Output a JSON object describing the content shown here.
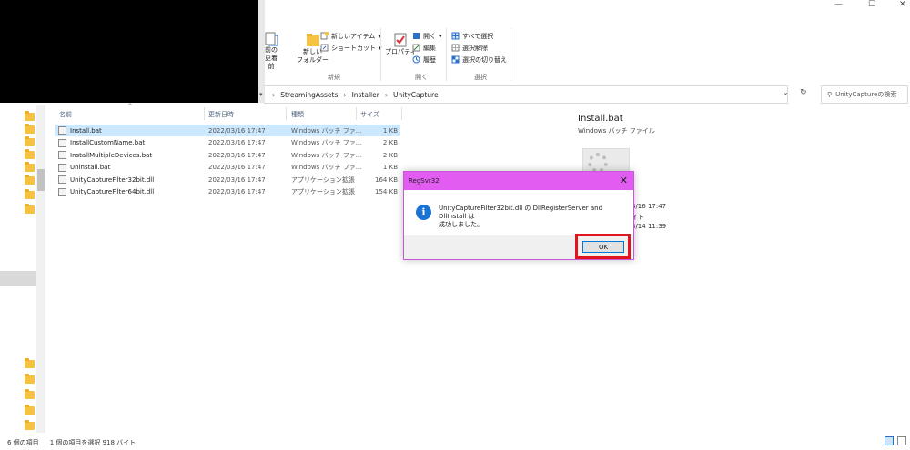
{
  "ribbon": {
    "truncated_copy_labels": [
      "コ",
      "剣"
    ],
    "move_label_lines": [
      "移動",
      "先"
    ],
    "copy_to_label_lines": [
      "前の",
      "更着",
      "前"
    ],
    "new_folder_label_lines": [
      "新しい",
      "フォルダー"
    ],
    "new_item_label": "新しいアイテム",
    "shortcut_label": "ショートカット",
    "new_group_label": "新規",
    "properties_label": "プロパティ",
    "open_label": "開く",
    "edit_label": "編集",
    "history_label": "履歴",
    "open_group_label": "開く",
    "select_all_label": "すべて選択",
    "select_none_label": "選択解除",
    "invert_selection_label": "選択の切り替え",
    "select_group_label": "選択"
  },
  "address": {
    "breadcrumbs": [
      "StreamingAssets",
      "Installer",
      "UnityCapture"
    ]
  },
  "search": {
    "placeholder": "UnityCaptureの検索"
  },
  "columns": {
    "name": "名前",
    "date": "更新日時",
    "type": "種類",
    "size": "サイズ"
  },
  "files": [
    {
      "name": "Install.bat",
      "date": "2022/03/16 17:47",
      "type": "Windows バッチ ファ...",
      "size": "1 KB",
      "selected": true
    },
    {
      "name": "InstallCustomName.bat",
      "date": "2022/03/16 17:47",
      "type": "Windows バッチ ファ...",
      "size": "2 KB"
    },
    {
      "name": "InstallMultipleDevices.bat",
      "date": "2022/03/16 17:47",
      "type": "Windows バッチ ファ...",
      "size": "2 KB"
    },
    {
      "name": "Uninstall.bat",
      "date": "2022/03/16 17:47",
      "type": "Windows バッチ ファ...",
      "size": "1 KB"
    },
    {
      "name": "UnityCaptureFilter32bit.dll",
      "date": "2022/03/16 17:47",
      "type": "アプリケーション拡張",
      "size": "164 KB"
    },
    {
      "name": "UnityCaptureFilter64bit.dll",
      "date": "2022/03/16 17:47",
      "type": "アプリケーション拡張",
      "size": "154 KB"
    }
  ],
  "preview": {
    "title": "Install.bat",
    "subtitle": "Windows バッチ ファイル",
    "detail_line1": "3/16 17:47",
    "detail_line2": "イト",
    "detail_line3": "3/14 11:39"
  },
  "dialog": {
    "title": "RegSvr32",
    "message_line1": "UnityCaptureFilter32bit.dll の DllRegisterServer and DllInstall は",
    "message_line2": "成功しました。",
    "ok_label": "OK",
    "close_glyph": "✕",
    "info_glyph": "i"
  },
  "status": {
    "item_count": "6 個の項目",
    "selection": "1 個の項目を選択  918 バイト"
  },
  "window_controls": {
    "minimize": "—",
    "maximize": "☐",
    "close": "✕"
  },
  "colors": {
    "dialog_title_bar": "#e35cf2",
    "highlight_box": "#e0141c",
    "selection": "#cce8ff",
    "folder": "#f6c244"
  }
}
